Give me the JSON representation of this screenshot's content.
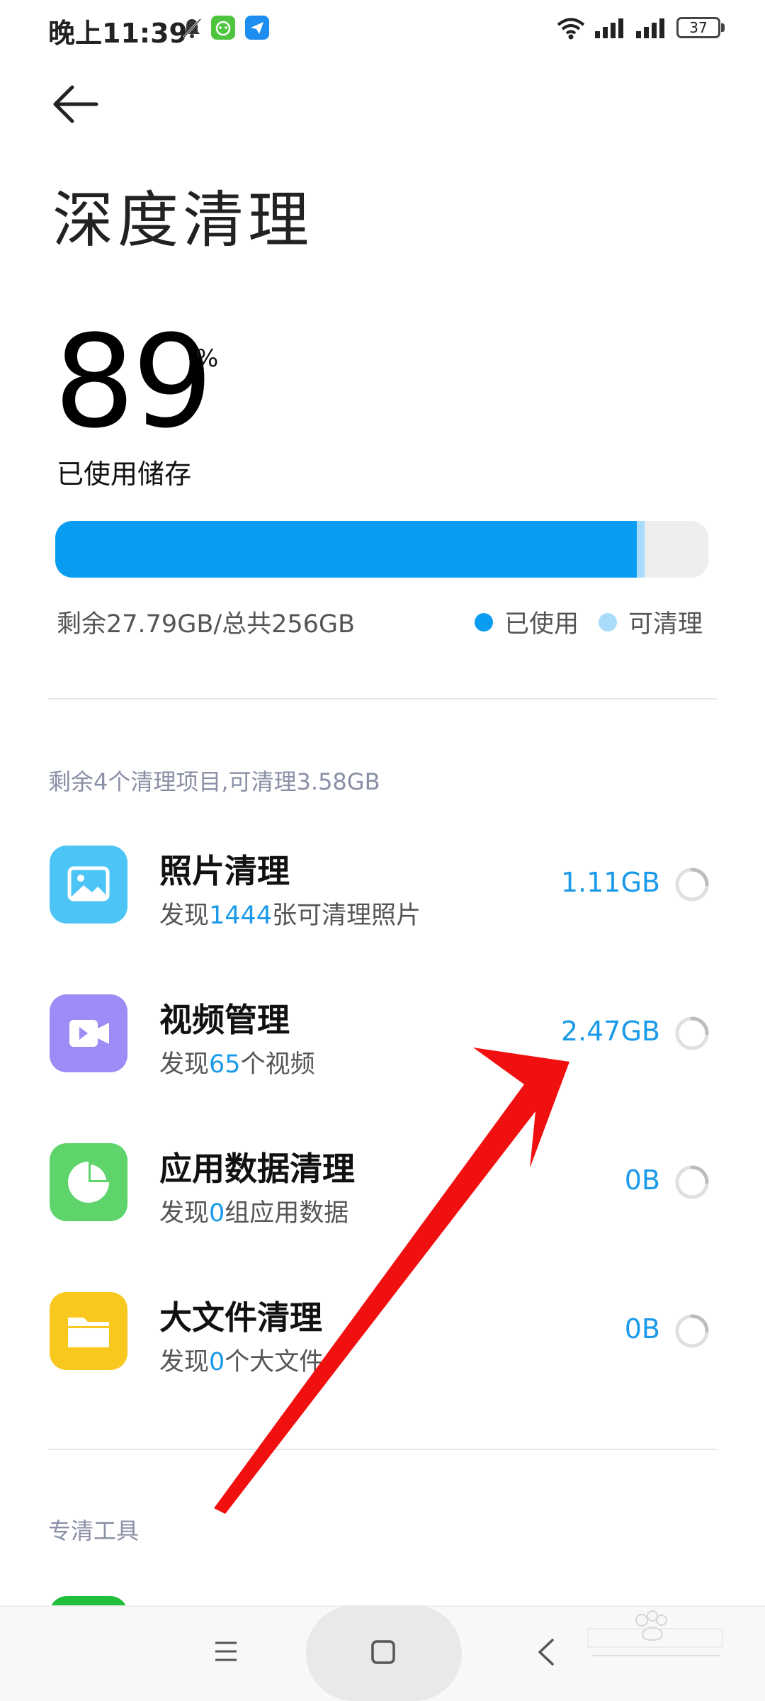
{
  "status_bar": {
    "time": "晚上11:39",
    "battery": "37",
    "icons": [
      "mute-bell-icon",
      "app-notification-icon",
      "send-icon",
      "wifi-icon",
      "signal-icon",
      "signal-icon",
      "battery-icon"
    ]
  },
  "header": {
    "title": "深度清理"
  },
  "usage": {
    "percent": "89",
    "percent_unit": "%",
    "label": "已使用储存",
    "used_fraction": 0.89,
    "cleanable_fraction": 0.012
  },
  "storage": {
    "summary": "剩余27.79GB/总共256GB",
    "legend": [
      {
        "label": "已使用",
        "color": "#0a9cf0"
      },
      {
        "label": "可清理",
        "color": "#a9dbfb"
      }
    ]
  },
  "cleanup": {
    "section_title": "剩余4个清理项目,可清理3.58GB",
    "items": [
      {
        "title": "照片清理",
        "desc_prefix": "发现",
        "desc_count": "1444",
        "desc_suffix": "张可清理照片",
        "size": "1.11GB",
        "icon": "photo-icon",
        "icon_color": "#4cc4f5"
      },
      {
        "title": "视频管理",
        "desc_prefix": "发现",
        "desc_count": "65",
        "desc_suffix": "个视频",
        "size": "2.47GB",
        "icon": "video-icon",
        "icon_color": "#9b8cf6"
      },
      {
        "title": "应用数据清理",
        "desc_prefix": "发现",
        "desc_count": "0",
        "desc_suffix": "组应用数据",
        "size": "0B",
        "icon": "pie-chart-icon",
        "icon_color": "#5ed46b"
      },
      {
        "title": "大文件清理",
        "desc_prefix": "发现",
        "desc_count": "0",
        "desc_suffix": "个大文件",
        "size": "0B",
        "icon": "folder-icon",
        "icon_color": "#f9c81e"
      }
    ]
  },
  "tools": {
    "section_title": "专清工具"
  },
  "nav": {
    "menu": "menu-icon",
    "home": "home-icon",
    "back": "back-icon"
  },
  "colors": {
    "accent": "#1a9ae8",
    "arrow": "#f01010"
  }
}
